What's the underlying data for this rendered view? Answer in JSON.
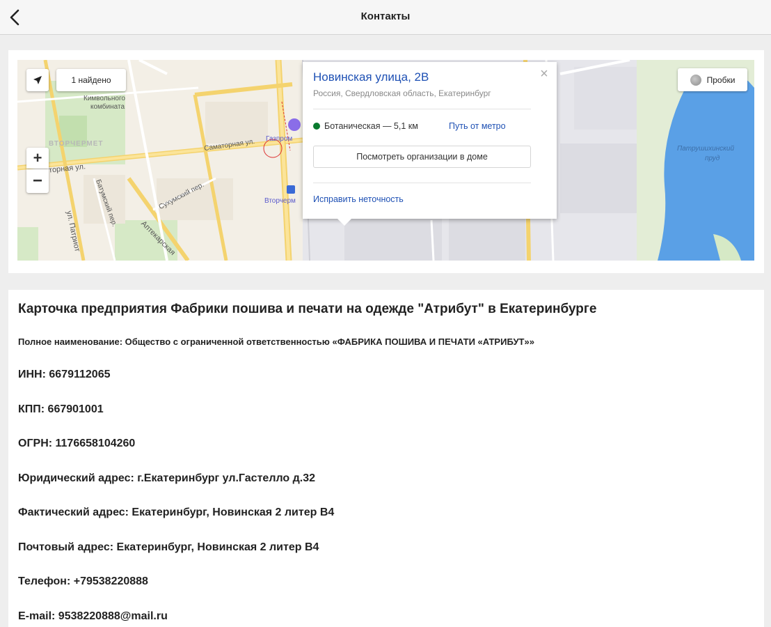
{
  "topbar": {
    "title": "Контакты"
  },
  "map": {
    "found_label": "1 найдено",
    "zoom_in": "+",
    "zoom_out": "−",
    "traffic_label": "Пробки",
    "labels": {
      "kombinat": "Кимвольного",
      "kombinat2": "комбината",
      "district": "ВТОРЧЕРМЕТ",
      "samotornaya": "Саматорная ул.",
      "gazprom": "Газпром",
      "torgovaya": "торная ул.",
      "batumsky": "Батумский пер.",
      "sukhumsky": "Сухумский пер.",
      "aptekarskaya": "Аптекарская",
      "patriotov": "ул. Патриот",
      "vtorchermet_stop": "Вторчерм",
      "pond": "Патрушихинский",
      "pond2": "пруд"
    }
  },
  "popup": {
    "title": "Новинская улица, 2В",
    "subtitle": "Россия, Свердловская область, Екатеринбург",
    "metro": "Ботаническая — 5,1 км",
    "metro_link": "Путь от метро",
    "orgs_button": "Посмотреть организации в доме",
    "fix_link": "Исправить неточность",
    "close": "×"
  },
  "company": {
    "title": "Карточка предприятия Фабрики пошива и печати на одежде \"Атрибут\" в Екатеринбурге",
    "full_name": "Полное наименование: Общество с ограниченной ответственностью «ФАБРИКА ПОШИВА И ПЕЧАТИ «АТРИБУТ»»",
    "inn": "ИНН: 6679112065",
    "kpp": "КПП: 667901001",
    "ogrn": "ОГРН: 1176658104260",
    "legal_address": "Юридический адрес: г.Екатеринбург ул.Гастелло д.32",
    "actual_address": "Фактический адрес: Екатеринбург, Новинская 2 литер В4",
    "postal_address": "Почтовый адрес: Екатеринбург, Новинская 2 литер В4",
    "phone": "Телефон: +79538220888",
    "email": "E-mail: 9538220888@mail.ru"
  },
  "colors": {
    "link": "#1e50b4",
    "metro": "#0a7a2e",
    "water": "#5aa0e6"
  }
}
